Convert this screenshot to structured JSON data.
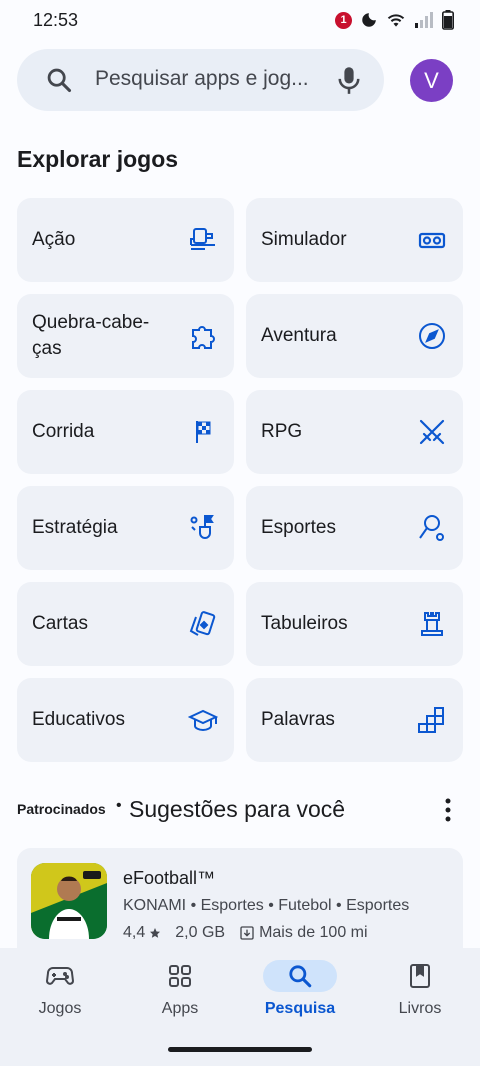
{
  "status_bar": {
    "time": "12:53",
    "notification_count": "1"
  },
  "search": {
    "placeholder": "Pesquisar apps e jog..."
  },
  "avatar": {
    "initial": "V",
    "color": "#7b3fc4"
  },
  "explore": {
    "title": "Explorar jogos",
    "categories": [
      {
        "label": "Ação",
        "icon": "action-icon"
      },
      {
        "label": "Simulador",
        "icon": "vr-headset-icon"
      },
      {
        "label": "Quebra-cabe-ças",
        "icon": "puzzle-icon"
      },
      {
        "label": "Aventura",
        "icon": "compass-icon"
      },
      {
        "label": "Corrida",
        "icon": "checkered-flag-icon"
      },
      {
        "label": "RPG",
        "icon": "crossed-swords-icon"
      },
      {
        "label": "Estratégia",
        "icon": "strategy-icon"
      },
      {
        "label": "Esportes",
        "icon": "sports-icon"
      },
      {
        "label": "Cartas",
        "icon": "cards-icon"
      },
      {
        "label": "Tabuleiros",
        "icon": "chess-rook-icon"
      },
      {
        "label": "Educativos",
        "icon": "graduation-cap-icon"
      },
      {
        "label": "Palavras",
        "icon": "word-tiles-icon"
      }
    ]
  },
  "suggestions": {
    "sponsored_label": "Patrocinados",
    "separator": "•",
    "title": "Sugestões para você",
    "app": {
      "name": "eFootball™",
      "meta": "KONAMI • Esportes • Futebol • Esportes",
      "rating": "4,4",
      "size": "2,0 GB",
      "downloads": "Mais de 100 mi"
    }
  },
  "bottom_nav": {
    "items": [
      {
        "label": "Jogos",
        "icon": "gamepad-icon",
        "active": false
      },
      {
        "label": "Apps",
        "icon": "apps-grid-icon",
        "active": false
      },
      {
        "label": "Pesquisa",
        "icon": "search-icon",
        "active": true
      },
      {
        "label": "Livros",
        "icon": "bookmark-book-icon",
        "active": false
      }
    ]
  },
  "colors": {
    "accent": "#0b57d0",
    "card_bg": "#eef1f7",
    "search_bg": "#e9eef6",
    "active_pill": "#cfe3fb"
  }
}
